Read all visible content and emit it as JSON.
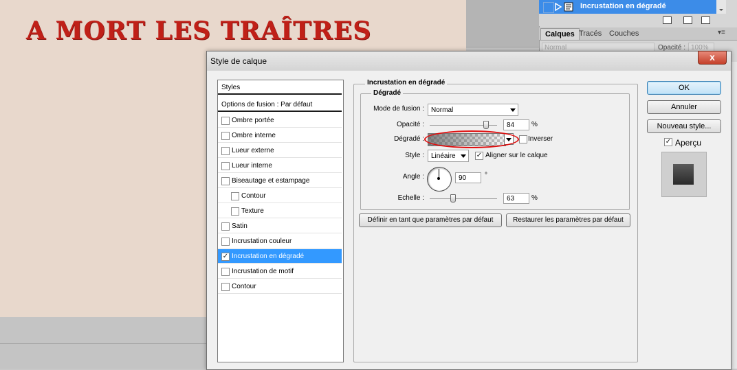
{
  "canvas": {
    "title": "A MORT LES TRAÎTRES"
  },
  "layers_panel": {
    "layer_name": "Incrustation en dégradé",
    "tabs": [
      "Calques",
      "Tracés",
      "Couches"
    ],
    "blend_mode": "Normal",
    "opacity_label": "Opacité :",
    "opacity_value": "100%"
  },
  "dialog": {
    "title": "Style de calque",
    "close_label": "x",
    "styles_header": "Styles",
    "blend_options": "Options de fusion : Par défaut",
    "effects": [
      {
        "label": "Ombre portée",
        "checked": false
      },
      {
        "label": "Ombre interne",
        "checked": false
      },
      {
        "label": "Lueur externe",
        "checked": false
      },
      {
        "label": "Lueur interne",
        "checked": false
      },
      {
        "label": "Biseautage et estampage",
        "checked": false
      },
      {
        "label": "Contour",
        "checked": false
      },
      {
        "label": "Texture",
        "checked": false
      },
      {
        "label": "Satin",
        "checked": false
      },
      {
        "label": "Incrustation couleur",
        "checked": false
      },
      {
        "label": "Incrustation en dégradé",
        "checked": true
      },
      {
        "label": "Incrustation de motif",
        "checked": false
      },
      {
        "label": "Contour",
        "checked": false
      }
    ],
    "panel": {
      "group_title": "Incrustation en dégradé",
      "sub_title": "Dégradé",
      "blend_label": "Mode de fusion :",
      "blend_value": "Normal",
      "opacity_label": "Opacité :",
      "opacity_value": "84",
      "opacity_fraction": 0.84,
      "gradient_label": "Dégradé :",
      "reverse_label": "Inverser",
      "reverse_checked": false,
      "style_label": "Style :",
      "style_value": "Linéaire",
      "align_label": "Aligner sur le calque",
      "align_checked": true,
      "angle_label": "Angle :",
      "angle_value": "90",
      "degree_symbol": "°",
      "scale_label": "Echelle :",
      "scale_value": "63",
      "scale_fraction": 0.35,
      "percent": "%",
      "set_default": "Définir en tant que paramètres par défaut",
      "reset_default": "Restaurer les paramètres par défaut"
    },
    "buttons": {
      "ok": "OK",
      "cancel": "Annuler",
      "new_style": "Nouveau style...",
      "preview_label": "Aperçu",
      "preview_checked": true
    }
  },
  "colors": {
    "title_red": "#c02018",
    "selection_blue": "#3399ff",
    "layer_blue": "#3c8ce8",
    "highlight_red": "#e01010"
  }
}
